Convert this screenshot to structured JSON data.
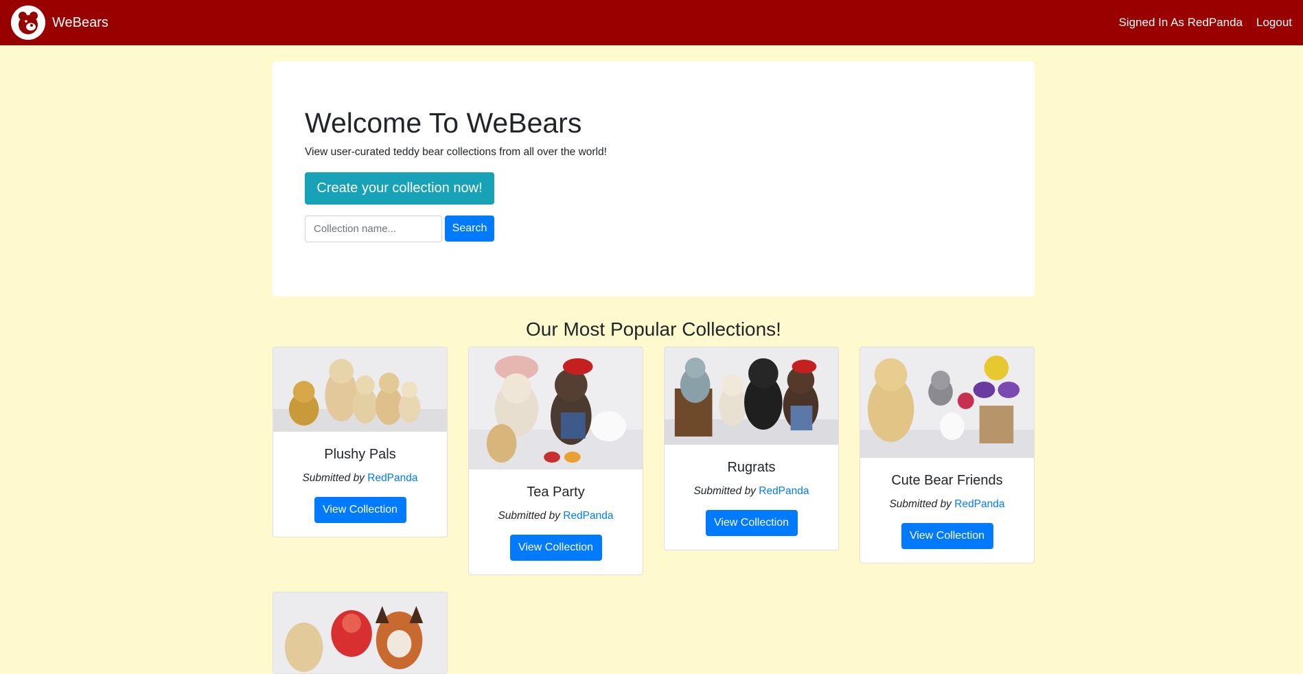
{
  "navbar": {
    "brand": "WeBears",
    "signed_in": "Signed In As RedPanda",
    "logout": "Logout"
  },
  "hero": {
    "title": "Welcome To WeBears",
    "subtitle": "View user-curated teddy bear collections from all over the world!",
    "create_button": "Create your collection now!",
    "search_placeholder": "Collection name...",
    "search_button": "Search"
  },
  "popular": {
    "title": "Our Most Popular Collections!",
    "submitted_by_label": "Submitted by",
    "view_button": "View Collection",
    "cards": [
      {
        "title": "Plushy Pals",
        "author": "RedPanda"
      },
      {
        "title": "Tea Party",
        "author": "RedPanda"
      },
      {
        "title": "Rugrats",
        "author": "RedPanda"
      },
      {
        "title": "Cute Bear Friends",
        "author": "RedPanda"
      }
    ]
  },
  "colors": {
    "navbar": "#990000",
    "page_background": "#fffacd",
    "primary": "#007bff",
    "info": "#17a2b8"
  }
}
